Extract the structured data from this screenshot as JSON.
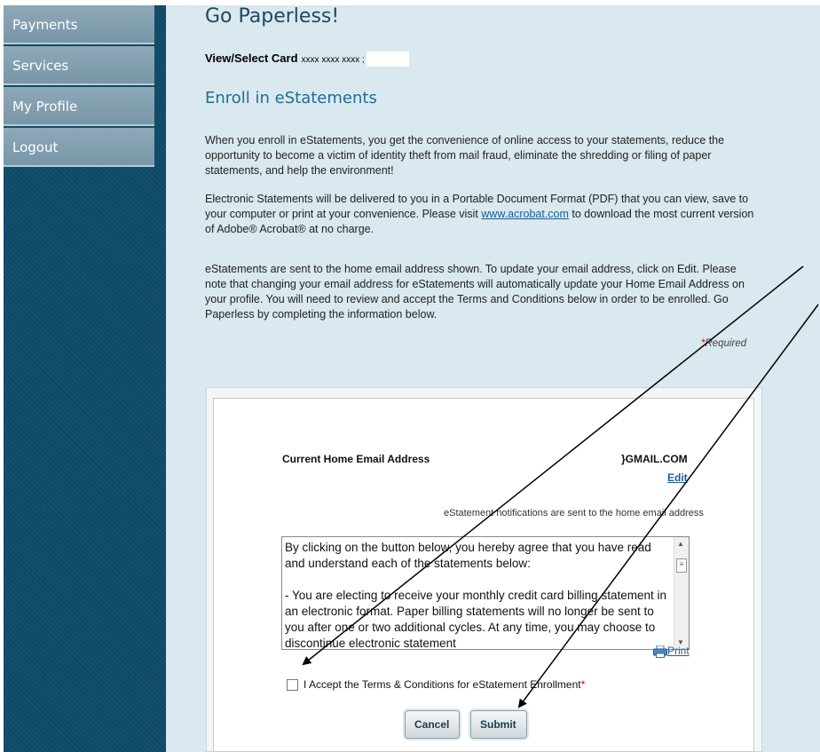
{
  "sidebar": {
    "items": [
      {
        "label": "Payments"
      },
      {
        "label": "Services"
      },
      {
        "label": "My Profile"
      },
      {
        "label": "Logout"
      }
    ]
  },
  "page": {
    "title": "Go Paperless!",
    "view_card_label": "View/Select Card",
    "card_mask": "xxxx xxxx xxxx ;",
    "subtitle": "Enroll in eStatements",
    "para1": "When you enroll in eStatements, you get the convenience of online access to your statements, reduce the opportunity to become a victim of identity theft from mail fraud, eliminate the shredding or filing of paper statements, and help the environment!",
    "para2_before": "Electronic Statements will be delivered to you in a Portable Document Format (PDF) that you can view, save to your computer or print at your convenience. Please visit ",
    "para2_link": "www.acrobat.com",
    "para2_after": " to download the most current version of Adobe® Acrobat® at no charge.",
    "para3": "eStatements are sent to the home email address shown. To update your email address, click on Edit. Please note that changing your email address for eStatements will automatically update your Home Email Address on your profile. You will need to review and accept the Terms and Conditions below in order to be enrolled. Go Paperless by completing the information below.",
    "required_star": "*",
    "required_label": "Required"
  },
  "form": {
    "email_label": "Current Home Email Address",
    "email_value": "}GMAIL.COM",
    "edit_label": "Edit",
    "notification_text": "eStatement notifications are sent to the home email address",
    "terms_p1": "By clicking on the button below, you hereby agree that you have read and understand each of the statements below:",
    "terms_p2": "- You are electing to receive your monthly credit card billing statement in an electronic format. Paper billing statements will no longer be sent to you after one or two additional cycles. At any time, you may choose to discontinue electronic statement",
    "print_label": "Print",
    "accept_label": "I Accept the Terms & Conditions for eStatement Enrollment",
    "accept_star": "*",
    "cancel_label": "Cancel",
    "submit_label": "Submit"
  }
}
